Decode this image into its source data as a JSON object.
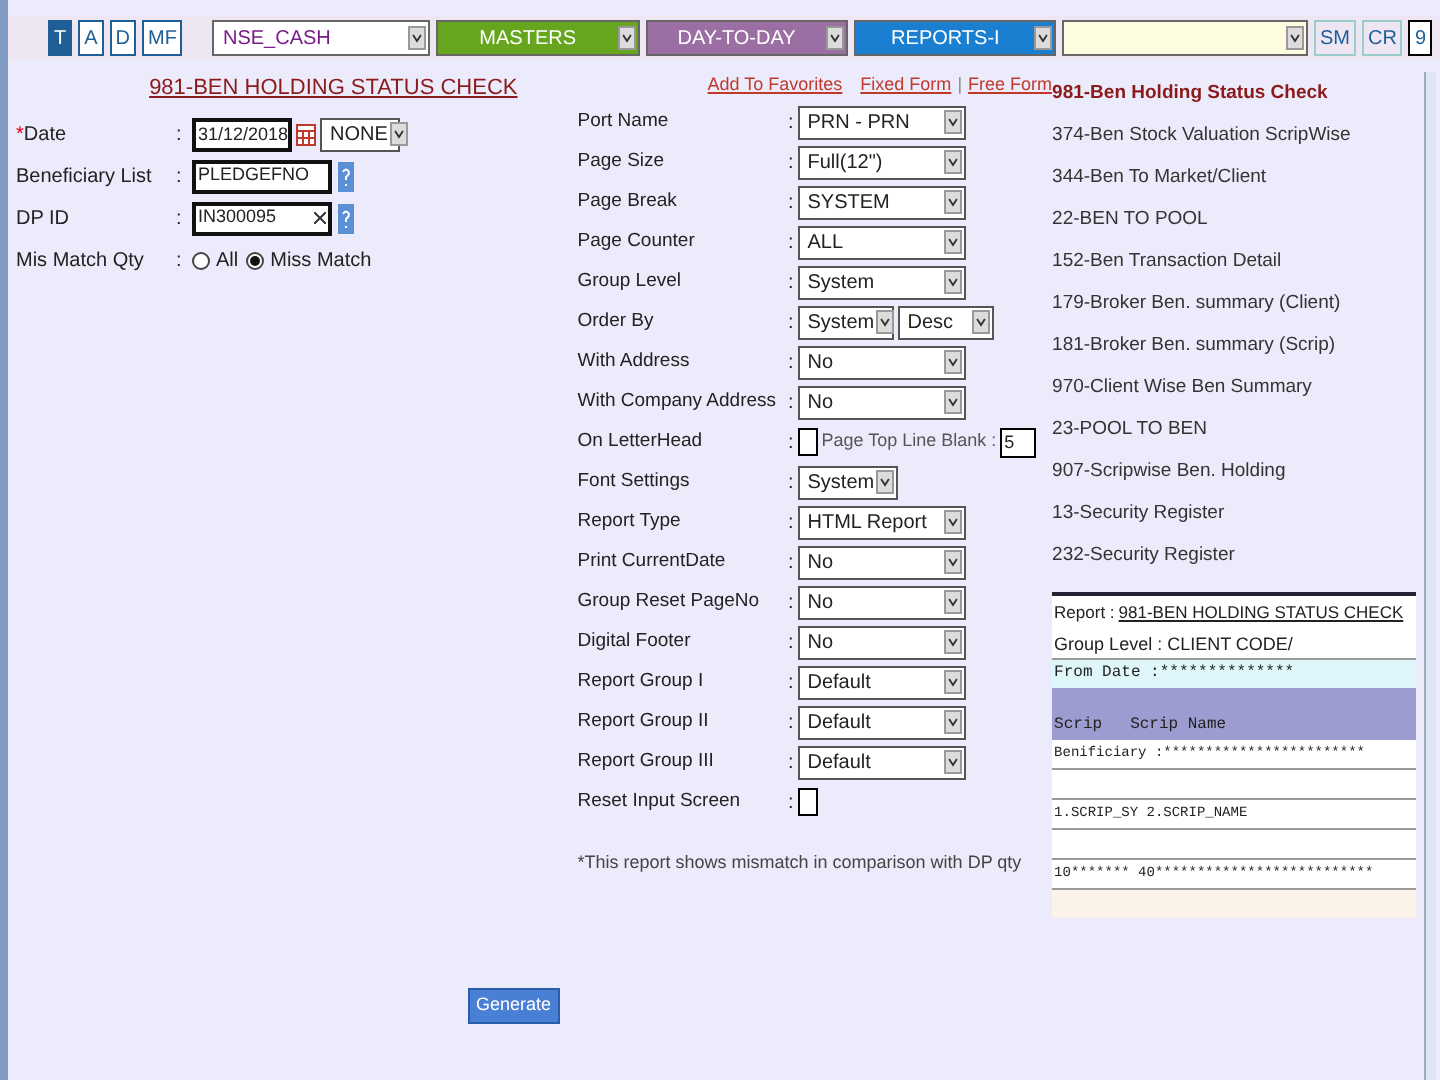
{
  "nav": {
    "tabs": [
      {
        "label": "T",
        "selected": true
      },
      {
        "label": "A",
        "selected": false
      },
      {
        "label": "D",
        "selected": false
      },
      {
        "label": "MF",
        "selected": false
      }
    ],
    "menus": [
      {
        "label": "NSE_CASH",
        "color": "#ffffff"
      },
      {
        "label": "MASTERS",
        "color": "#66a61e"
      },
      {
        "label": "DAY-TO-DAY",
        "color": "#9b6fa3"
      },
      {
        "label": "REPORTS-I",
        "color": "#1a7fd0"
      },
      {
        "color": "#fdfbe0"
      }
    ],
    "shortcuts": [
      "SM",
      "CR",
      "9"
    ]
  },
  "title": "981-BEN HOLDING STATUS CHECK",
  "left_fields": [
    {
      "kind": "date",
      "required_mark": "*",
      "label": "Date",
      "colon": ":",
      "value": "31/12/2018",
      "option": "NONE"
    },
    {
      "kind": "lookup",
      "label": "Beneficiary List",
      "colon": ":",
      "value": "PLEDGEFNO"
    },
    {
      "kind": "lookup_clear",
      "label": "DP ID",
      "colon": ":",
      "value": "IN300095"
    },
    {
      "kind": "radio",
      "label": "Mis Match Qty",
      "colon": ":",
      "options": [
        {
          "label": "All",
          "selected": false
        },
        {
          "label": "Miss Match",
          "selected": true
        }
      ]
    }
  ],
  "links": [
    {
      "kind": "link",
      "text": "Add To Favorites"
    },
    {
      "kind": "link",
      "text": "Fixed Form"
    },
    {
      "kind": "separator",
      "text": "|"
    },
    {
      "kind": "link",
      "text": "Free Form"
    }
  ],
  "settings": [
    {
      "kind": "select",
      "label": "Port Name",
      "colon": ":",
      "value": "PRN - PRN"
    },
    {
      "kind": "select",
      "label": "Page Size",
      "colon": ":",
      "value": "Full(12\")"
    },
    {
      "kind": "select",
      "label": "Page Break",
      "colon": ":",
      "value": "SYSTEM"
    },
    {
      "kind": "select",
      "label": "Page Counter",
      "colon": ":",
      "value": "ALL"
    },
    {
      "kind": "select",
      "label": "Group Level",
      "colon": ":",
      "value": "System"
    },
    {
      "kind": "pair",
      "label": "Order By",
      "colon": ":",
      "values": [
        "System",
        "Desc"
      ]
    },
    {
      "kind": "select",
      "label": "With Address",
      "colon": ":",
      "value": "No"
    },
    {
      "kind": "select",
      "label": "With Company Address",
      "colon": ":",
      "value": "No"
    },
    {
      "kind": "checkbox",
      "label": "On LetterHead",
      "colon": ":",
      "checked": false,
      "extra_label": "Page Top Line Blank :",
      "extra_value": "5"
    },
    {
      "kind": "short",
      "label": "Font Settings",
      "colon": ":",
      "value": "System"
    },
    {
      "kind": "select",
      "label": "Report Type",
      "colon": ":",
      "value": "HTML Report"
    },
    {
      "kind": "select",
      "label": "Print CurrentDate",
      "colon": ":",
      "value": "No"
    },
    {
      "kind": "select",
      "label": "Group Reset PageNo",
      "colon": ":",
      "value": "No"
    },
    {
      "kind": "select",
      "label": "Digital Footer",
      "colon": ":",
      "value": "No"
    },
    {
      "kind": "select",
      "label": "Report Group I",
      "colon": ":",
      "value": "Default"
    },
    {
      "kind": "select",
      "label": "Report Group II",
      "colon": ":",
      "value": "Default"
    },
    {
      "kind": "select",
      "label": "Report Group III",
      "colon": ":",
      "value": "Default"
    },
    {
      "kind": "checkbox",
      "label": "Reset Input Screen",
      "colon": ":",
      "checked": false
    }
  ],
  "note": "*This report shows mismatch in comparison with DP qty",
  "reports": [
    {
      "label": "981-Ben Holding Status Check",
      "selected": true
    },
    {
      "label": "374-Ben Stock Valuation ScripWise",
      "selected": false
    },
    {
      "label": "344-Ben To Market/Client",
      "selected": false
    },
    {
      "label": "22-BEN TO POOL",
      "selected": false
    },
    {
      "label": "152-Ben Transaction Detail",
      "selected": false
    },
    {
      "label": "179-Broker Ben. summary (Client)",
      "selected": false
    },
    {
      "label": "181-Broker Ben. summary (Scrip)",
      "selected": false
    },
    {
      "label": "970-Client Wise Ben Summary",
      "selected": false
    },
    {
      "label": "23-POOL TO BEN",
      "selected": false
    },
    {
      "label": "907-Scripwise Ben. Holding",
      "selected": false
    },
    {
      "label": "13-Security Register",
      "selected": false
    },
    {
      "label": "232-Security Register",
      "selected": false
    }
  ],
  "preview": {
    "report_label": "Report :",
    "report_name": "981-BEN HOLDING STATUS CHECK",
    "group_level": "Group Level : CLIENT CODE/",
    "from_date": "From Date :**************",
    "columns": [
      "Scrip",
      "Scrip Name"
    ],
    "lines": [
      {
        "kind": "text",
        "text": "Benificiary :************************"
      },
      {
        "kind": "blank"
      },
      {
        "kind": "text",
        "text": "1.SCRIP_SY 2.SCRIP_NAME"
      },
      {
        "kind": "blank"
      },
      {
        "kind": "text",
        "text": "10******* 40**************************"
      }
    ]
  },
  "generate": "Generate"
}
